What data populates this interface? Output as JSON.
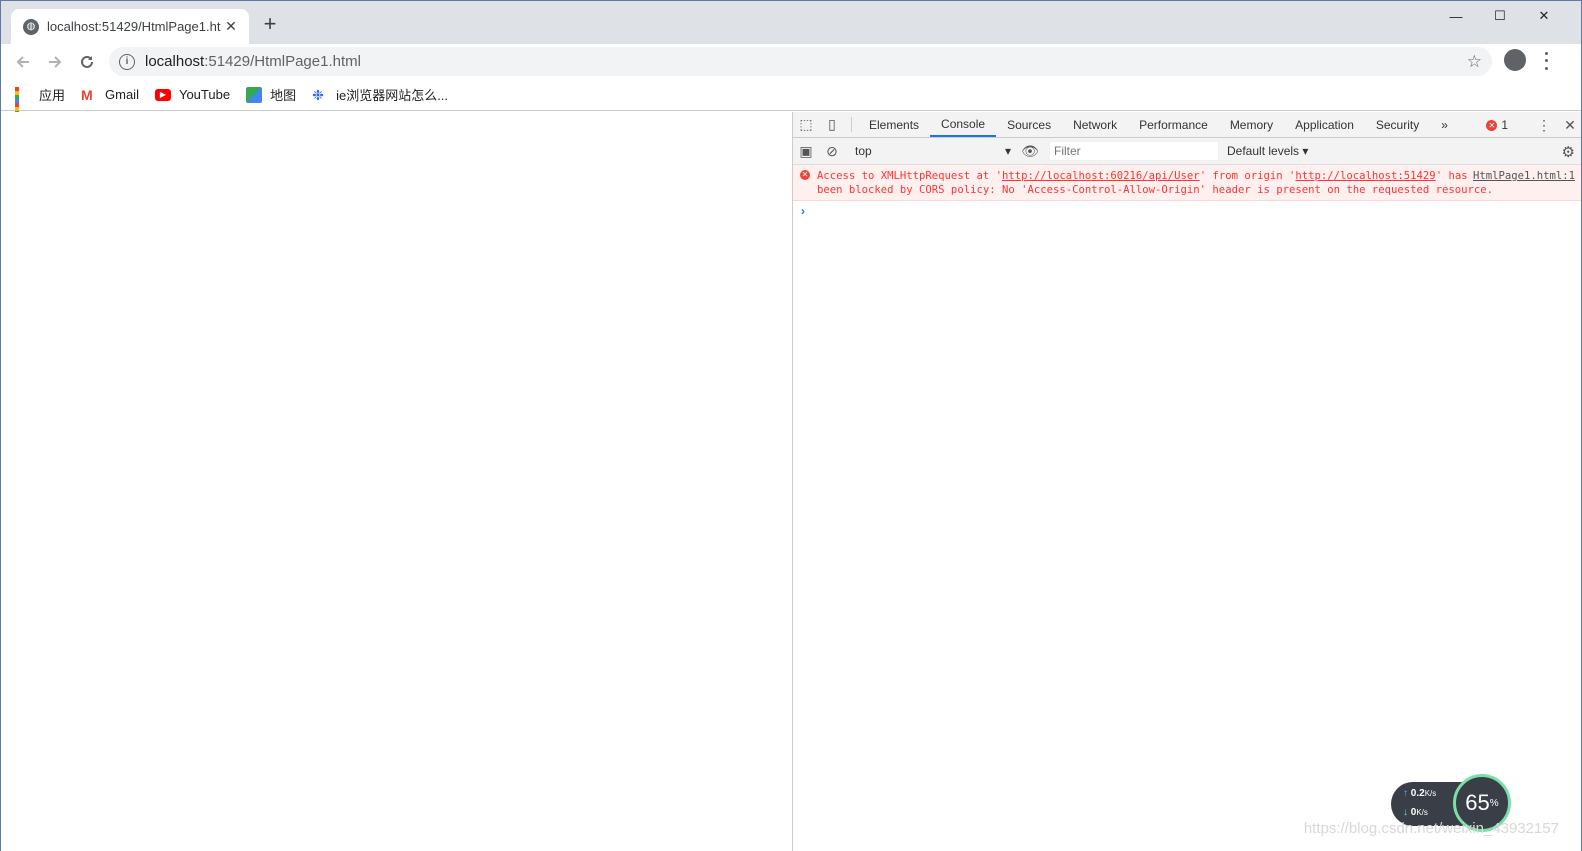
{
  "browser": {
    "tab_title": "localhost:51429/HtmlPage1.ht",
    "new_tab": "+",
    "window_controls": {
      "minimize": "—",
      "maximize": "☐",
      "close": "✕"
    },
    "url_host": "localhost",
    "url_rest": ":51429/HtmlPage1.html",
    "bookmarks": [
      {
        "label": "应用",
        "icon": "apps-grid-icon"
      },
      {
        "label": "Gmail",
        "icon": "gmail-icon"
      },
      {
        "label": "YouTube",
        "icon": "youtube-icon"
      },
      {
        "label": "地图",
        "icon": "maps-icon"
      },
      {
        "label": "ie浏览器网站怎么...",
        "icon": "baidu-paw-icon"
      }
    ]
  },
  "devtools": {
    "tabs": [
      "Elements",
      "Console",
      "Sources",
      "Network",
      "Performance",
      "Memory",
      "Application",
      "Security"
    ],
    "active_tab": "Console",
    "more_tabs": "»",
    "error_count": "1",
    "context": "top",
    "filter_placeholder": "Filter",
    "levels": "Default levels ▾",
    "messages": [
      {
        "level": "error",
        "text_1": "Access to XMLHttpRequest at '",
        "link_1": "http://localhost:60216/api/User",
        "text_2": "' from origin '",
        "link_2": "http://localhost:51429",
        "text_3": "' has been blocked by CORS policy: No 'Access-Control-Allow-Origin' header is present on the requested resource.",
        "source": "HtmlPage1.html:1"
      }
    ],
    "prompt": "›"
  },
  "net_widget": {
    "up": "0.2",
    "up_unit": "K/s",
    "down": "0",
    "down_unit": "K/s",
    "percent": "65",
    "percent_unit": "%"
  },
  "watermark": "https://blog.csdn.net/weixin_43932157",
  "colors": {
    "tab_strip": "#dee1e6",
    "devtools_accent": "#1a73e8",
    "error_text": "#ff3333",
    "error_bg": "#fff0f0"
  }
}
